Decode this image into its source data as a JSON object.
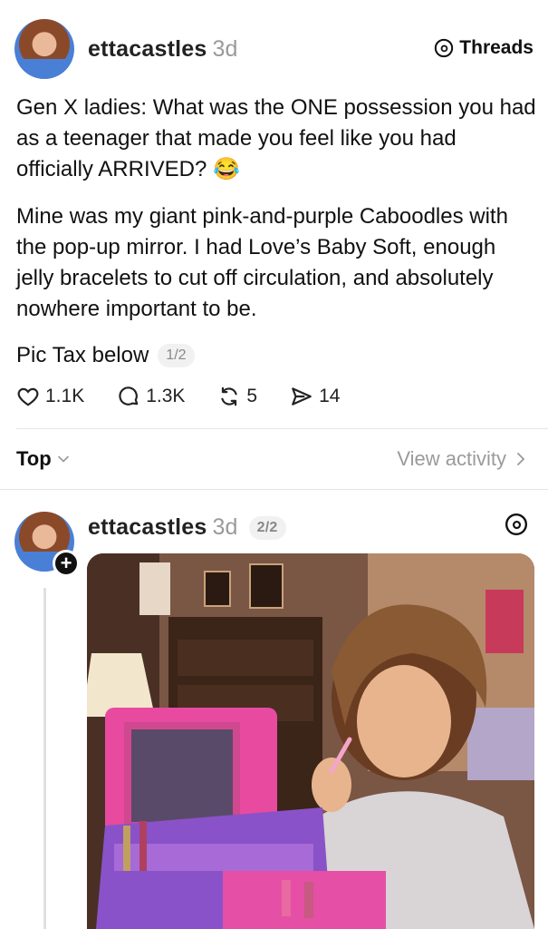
{
  "post": {
    "username": "ettacastles",
    "time": "3d",
    "brand": "Threads",
    "paragraph1": "Gen X ladies: What was the ONE possession you had as a teenager that made you feel like you had officially ARRIVED? 😂",
    "paragraph2": "Mine was my giant pink-and-purple Caboodles with the pop-up mirror. I had Love’s Baby Soft, enough jelly bracelets to cut off circulation, and absolutely nowhere important to be.",
    "pic_tax": "Pic Tax below",
    "page": "1/2",
    "likes": "1.1K",
    "comments": "1.3K",
    "reposts": "5",
    "shares": "14"
  },
  "sort": {
    "label": "Top",
    "view_activity": "View activity"
  },
  "reply": {
    "username": "ettacastles",
    "time": "3d",
    "page": "2/2"
  },
  "icons": {
    "like": "heart-icon",
    "comment": "comment-bubble-icon",
    "repost": "repost-icon",
    "share": "send-icon",
    "brand": "threads-logo-icon"
  }
}
